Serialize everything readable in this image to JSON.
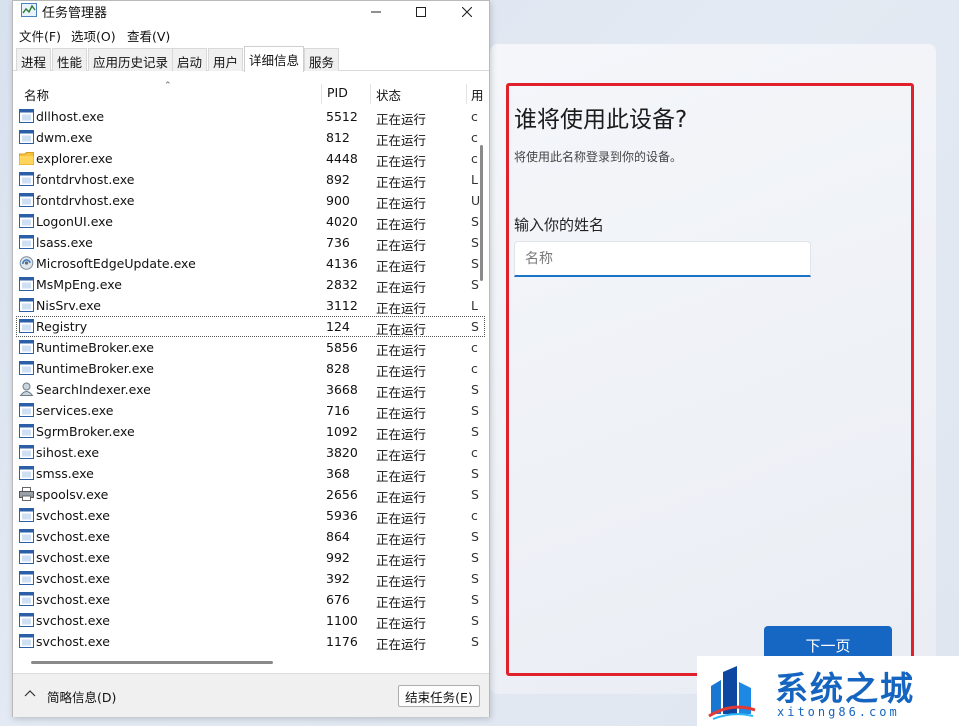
{
  "task_manager": {
    "title": "任务管理器",
    "menu": [
      "文件(F)",
      "选项(O)",
      "查看(V)"
    ],
    "tabs": [
      "进程",
      "性能",
      "应用历史记录",
      "启动",
      "用户",
      "详细信息",
      "服务"
    ],
    "active_tab": "详细信息",
    "columns": {
      "name": "名称",
      "pid": "PID",
      "status": "状态",
      "extra": "用"
    },
    "rows": [
      {
        "name": "dllhost.exe",
        "pid": "5512",
        "status": "正在运行",
        "extra": "c",
        "icon": "process-window-icon"
      },
      {
        "name": "dwm.exe",
        "pid": "812",
        "status": "正在运行",
        "extra": "c",
        "icon": "process-window-icon"
      },
      {
        "name": "explorer.exe",
        "pid": "4448",
        "status": "正在运行",
        "extra": "c",
        "icon": "folder-icon"
      },
      {
        "name": "fontdrvhost.exe",
        "pid": "892",
        "status": "正在运行",
        "extra": "L",
        "icon": "process-window-icon"
      },
      {
        "name": "fontdrvhost.exe",
        "pid": "900",
        "status": "正在运行",
        "extra": "U",
        "icon": "process-window-icon"
      },
      {
        "name": "LogonUI.exe",
        "pid": "4020",
        "status": "正在运行",
        "extra": "S",
        "icon": "process-window-icon"
      },
      {
        "name": "lsass.exe",
        "pid": "736",
        "status": "正在运行",
        "extra": "S",
        "icon": "process-window-icon"
      },
      {
        "name": "MicrosoftEdgeUpdate.exe",
        "pid": "4136",
        "status": "正在运行",
        "extra": "S",
        "icon": "edge-update-icon"
      },
      {
        "name": "MsMpEng.exe",
        "pid": "2832",
        "status": "正在运行",
        "extra": "S",
        "icon": "process-window-icon"
      },
      {
        "name": "NisSrv.exe",
        "pid": "3112",
        "status": "正在运行",
        "extra": "L",
        "icon": "process-window-icon"
      },
      {
        "name": "Registry",
        "pid": "124",
        "status": "正在运行",
        "extra": "S",
        "icon": "process-window-icon"
      },
      {
        "name": "RuntimeBroker.exe",
        "pid": "5856",
        "status": "正在运行",
        "extra": "c",
        "icon": "process-window-icon"
      },
      {
        "name": "RuntimeBroker.exe",
        "pid": "828",
        "status": "正在运行",
        "extra": "c",
        "icon": "process-window-icon"
      },
      {
        "name": "SearchIndexer.exe",
        "pid": "3668",
        "status": "正在运行",
        "extra": "S",
        "icon": "search-indexer-icon"
      },
      {
        "name": "services.exe",
        "pid": "716",
        "status": "正在运行",
        "extra": "S",
        "icon": "process-window-icon"
      },
      {
        "name": "SgrmBroker.exe",
        "pid": "1092",
        "status": "正在运行",
        "extra": "S",
        "icon": "process-window-icon"
      },
      {
        "name": "sihost.exe",
        "pid": "3820",
        "status": "正在运行",
        "extra": "c",
        "icon": "process-window-icon"
      },
      {
        "name": "smss.exe",
        "pid": "368",
        "status": "正在运行",
        "extra": "S",
        "icon": "process-window-icon"
      },
      {
        "name": "spoolsv.exe",
        "pid": "2656",
        "status": "正在运行",
        "extra": "S",
        "icon": "printer-icon"
      },
      {
        "name": "svchost.exe",
        "pid": "5936",
        "status": "正在运行",
        "extra": "c",
        "icon": "process-window-icon"
      },
      {
        "name": "svchost.exe",
        "pid": "864",
        "status": "正在运行",
        "extra": "S",
        "icon": "process-window-icon"
      },
      {
        "name": "svchost.exe",
        "pid": "992",
        "status": "正在运行",
        "extra": "S",
        "icon": "process-window-icon"
      },
      {
        "name": "svchost.exe",
        "pid": "392",
        "status": "正在运行",
        "extra": "S",
        "icon": "process-window-icon"
      },
      {
        "name": "svchost.exe",
        "pid": "676",
        "status": "正在运行",
        "extra": "S",
        "icon": "process-window-icon"
      },
      {
        "name": "svchost.exe",
        "pid": "1100",
        "status": "正在运行",
        "extra": "S",
        "icon": "process-window-icon"
      },
      {
        "name": "svchost.exe",
        "pid": "1176",
        "status": "正在运行",
        "extra": "S",
        "icon": "process-window-icon"
      }
    ],
    "selected_row": "Registry",
    "footer": {
      "fewer_details": "简略信息(D)",
      "end_task": "结束任务(E)"
    }
  },
  "oobe": {
    "title": "谁将使用此设备?",
    "subtitle": "将使用此名称登录到你的设备。",
    "name_label": "输入你的姓名",
    "name_placeholder": "名称",
    "name_value": "",
    "next_button": "下一页",
    "highlight_color": "#e0212b",
    "accent_color": "#1567c3"
  },
  "watermark": {
    "name": "系统之城",
    "url": "xitong86.com",
    "color": "#1565c0"
  }
}
